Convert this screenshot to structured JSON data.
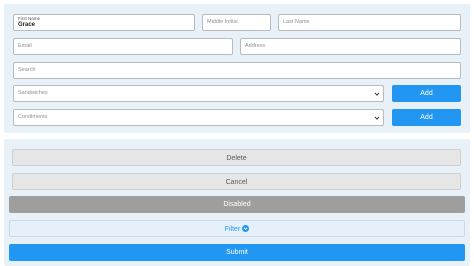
{
  "form": {
    "first_name": {
      "label": "First Name",
      "value": "Grace"
    },
    "middle_initial": {
      "placeholder": "Middle Initial"
    },
    "last_name": {
      "placeholder": "Last Name"
    },
    "email": {
      "placeholder": "Email"
    },
    "address": {
      "placeholder": "Address"
    },
    "search": {
      "placeholder": "Search"
    },
    "sandwiches": {
      "placeholder": "Sandwiches",
      "add_label": "Add"
    },
    "condiments": {
      "placeholder": "Condiments",
      "add_label": "Add"
    }
  },
  "actions": {
    "delete_label": "Delete",
    "cancel_label": "Cancel",
    "disabled_label": "Disabled",
    "filter_label": "Filter",
    "submit_label": "Submit"
  },
  "colors": {
    "primary": "#2196f3",
    "panel": "#e8f0f8",
    "disabled": "#9e9e9e"
  },
  "icons": {
    "dropdown": "chevron-down-icon",
    "filter": "chevron-circle-down-icon"
  }
}
